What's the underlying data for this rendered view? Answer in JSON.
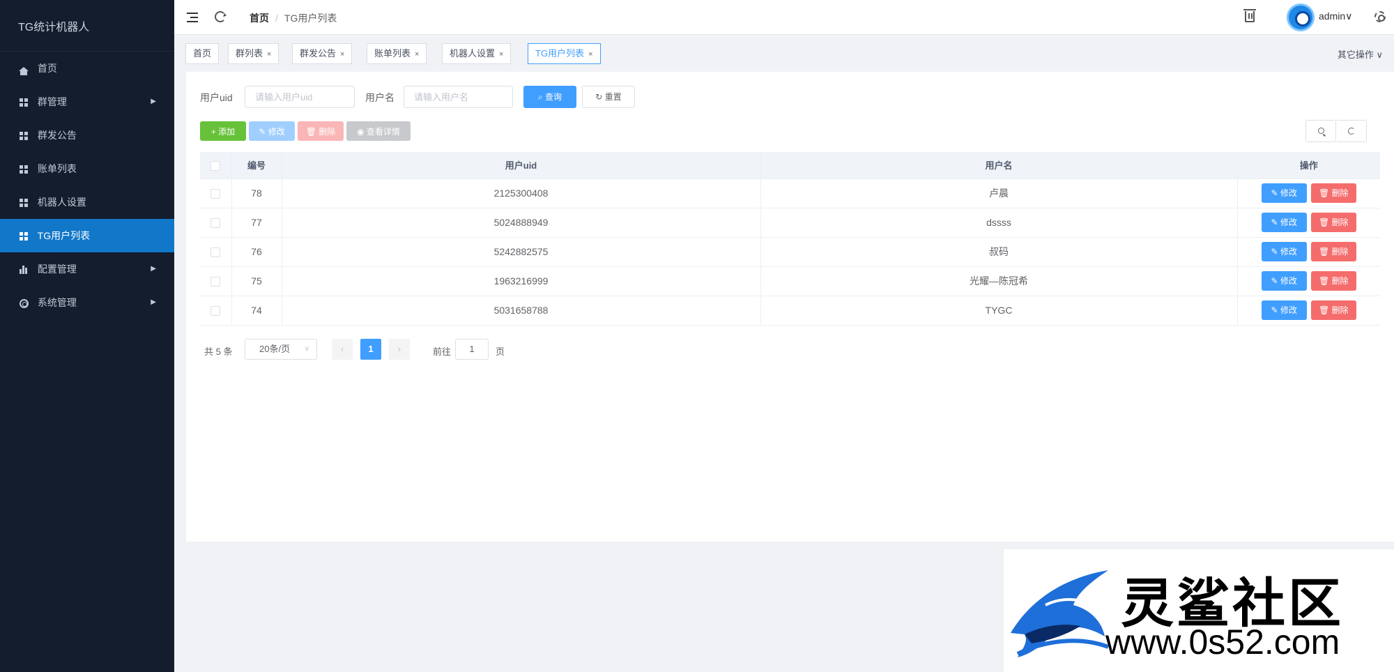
{
  "app": {
    "brand": "TG统计机器人"
  },
  "sidebar": {
    "items": [
      {
        "label": "首页"
      },
      {
        "label": "群管理"
      },
      {
        "label": "群发公告"
      },
      {
        "label": "账单列表"
      },
      {
        "label": "机器人设置"
      },
      {
        "label": "TG用户列表"
      },
      {
        "label": "配置管理"
      },
      {
        "label": "系统管理"
      }
    ],
    "active_color": "#1177c9"
  },
  "header": {
    "breadcrumb_home": "首页",
    "breadcrumb_sep": "/",
    "breadcrumb_current": "TG用户列表",
    "user_name": "admin",
    "user_chevron": "∨"
  },
  "tags": {
    "items": [
      {
        "label": "首页"
      },
      {
        "label": "群列表"
      },
      {
        "label": "群发公告"
      },
      {
        "label": "账单列表"
      },
      {
        "label": "机器人设置"
      },
      {
        "label": "TG用户列表"
      }
    ],
    "close_glyph": "×",
    "other_ops": "其它操作 ∨"
  },
  "search": {
    "uid_label": "用户uid",
    "uid_placeholder": "请输入用户uid",
    "name_label": "用户名",
    "name_placeholder": "请输入用户名",
    "query_btn": "查询",
    "reset_btn": "重置"
  },
  "toolbar": {
    "add": "添加",
    "edit": "修改",
    "delete": "删除",
    "detail": "查看详情"
  },
  "table": {
    "headers": [
      "编号",
      "用户uid",
      "用户名",
      "操作"
    ],
    "rows": [
      {
        "id": "78",
        "uid": "2125300408",
        "name": "卢晨"
      },
      {
        "id": "77",
        "uid": "5024888949",
        "name": "dssss"
      },
      {
        "id": "76",
        "uid": "5242882575",
        "name": "叔码"
      },
      {
        "id": "75",
        "uid": "1963216999",
        "name": "光耀—陈冠希"
      },
      {
        "id": "74",
        "uid": "5031658788",
        "name": "TYGC"
      }
    ],
    "row_edit": "修改",
    "row_delete": "删除"
  },
  "pagination": {
    "total": "共 5 条",
    "page_size": "20条/页",
    "prev": "‹",
    "current": "1",
    "next": "›",
    "goto_label": "前往",
    "goto_value": "1",
    "page_suffix": "页"
  },
  "watermark": {
    "title": "灵鲨社区",
    "url": "www.0s52.com"
  },
  "colors": {
    "primary": "#409eff",
    "success": "#67c23a",
    "danger": "#f56c6c",
    "sidebar_bg": "#131d2d"
  }
}
